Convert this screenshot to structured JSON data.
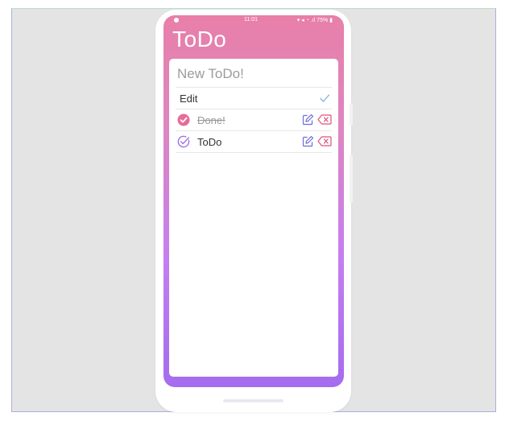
{
  "status_bar": {
    "time": "11:01",
    "indicators": "▾ ◂ ◔ .ıl 75% ▮"
  },
  "app": {
    "title": "ToDo"
  },
  "new_todo": {
    "placeholder": "New ToDo!",
    "value": ""
  },
  "edit_row": {
    "label": "Edit",
    "confirm_icon": "check-icon"
  },
  "todos": [
    {
      "text": "Done!",
      "completed": true,
      "status_icon": "check-circle-filled-icon"
    },
    {
      "text": "ToDo",
      "completed": false,
      "status_icon": "check-circle-outline-icon"
    }
  ],
  "colors": {
    "gradient_top": "#e87fa8",
    "gradient_bottom": "#a46cef",
    "done_pink": "#e86a99",
    "todo_purple": "#9c6ee8",
    "edit_blue": "#6a6cdc",
    "delete_pink": "#e0517a",
    "check_blue": "#7fb0e0"
  }
}
